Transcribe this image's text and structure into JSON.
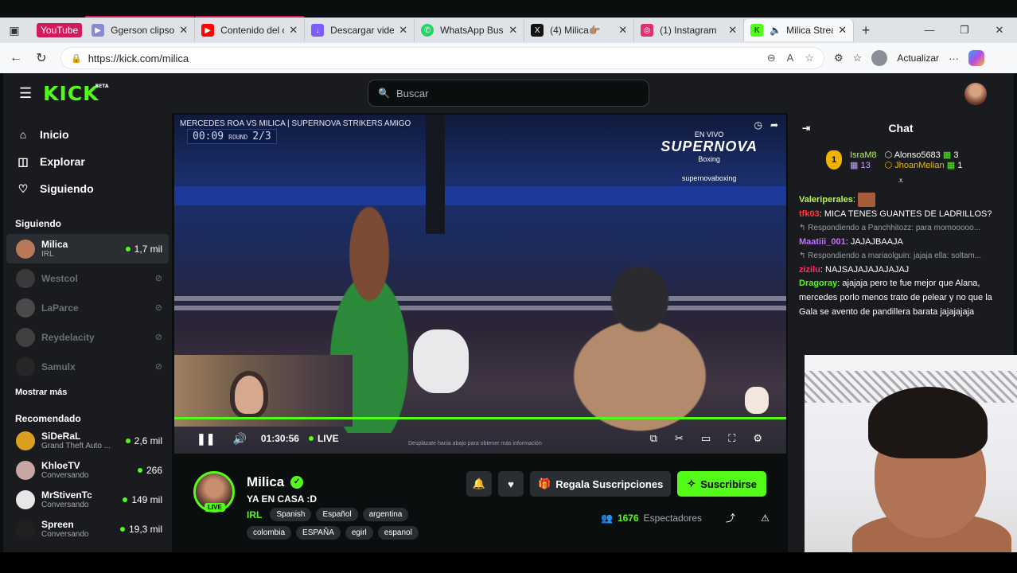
{
  "browser": {
    "tab_group_label": "YouTube",
    "tabs": [
      {
        "title": "Ggerson clipso -",
        "icon": "video-editor-icon",
        "color": "#8a8ad0"
      },
      {
        "title": "Contenido del c",
        "icon": "youtube-icon",
        "color": "#ff0000"
      },
      {
        "title": "Descargar video",
        "icon": "download-icon",
        "color": "#7c5cff"
      },
      {
        "title": "WhatsApp Busin",
        "icon": "whatsapp-icon",
        "color": "#25d366"
      },
      {
        "title": "(4) Milica👉🏽",
        "icon": "x-icon",
        "color": "#111111"
      },
      {
        "title": "(1) Instagram",
        "icon": "instagram-icon",
        "color": "#e1306c"
      },
      {
        "title": "Milica Strea",
        "icon": "kick-icon",
        "color": "#53fc18"
      }
    ],
    "url": "https://kick.com/milica",
    "update_label": "Actualizar"
  },
  "kick": {
    "logo": "KICK",
    "logo_badge": "BETA",
    "search_placeholder": "Buscar",
    "nav": [
      {
        "label": "Inicio",
        "icon": "home-icon"
      },
      {
        "label": "Explorar",
        "icon": "compass-icon"
      },
      {
        "label": "Siguiendo",
        "icon": "heart-icon"
      }
    ],
    "following_title": "Siguiendo",
    "following": [
      {
        "name": "Milica",
        "sub": "IRL",
        "viewers": "1,7 mil",
        "color": "#b8785a"
      },
      {
        "name": "Westcol",
        "color": "#3a3a3a"
      },
      {
        "name": "LaParce",
        "color": "#4a4a4a"
      },
      {
        "name": "Reydelacity",
        "color": "#404040"
      },
      {
        "name": "Samulx",
        "color": "#262626"
      }
    ],
    "show_more": "Mostrar más",
    "recommended_title": "Recomendado",
    "recommended": [
      {
        "name": "SiDeRaL",
        "sub": "Grand Theft Auto ...",
        "viewers": "2,6 mil",
        "color": "#d9a020"
      },
      {
        "name": "KhloeTV",
        "sub": "Conversando",
        "viewers": "266",
        "color": "#c9a6a0"
      },
      {
        "name": "MrStivenTc",
        "sub": "Conversando",
        "viewers": "149 mil",
        "color": "#e7e7e7"
      },
      {
        "name": "Spreen",
        "sub": "Conversando",
        "viewers": "19,3 mil",
        "color": "#202020"
      }
    ]
  },
  "video": {
    "title": "MERCEDES ROA VS MILICA | SUPERNOVA STRIKERS AMIGO",
    "clock": "00:09",
    "round_label": "ROUND",
    "round": "2/3",
    "sponsor_live": "EN VIVO",
    "sponsor_brand": "SUPERNOVA",
    "sponsor_sub": "Boxing",
    "sponsor_handle": "supernovaboxing",
    "elapsed": "01:30:56",
    "live_label": "LIVE",
    "hint": "Desplázate hacia abajo para obtener más información"
  },
  "stream": {
    "name": "Milica",
    "title": "YA EN CASA :D",
    "live_tag": "LIVE",
    "category": "IRL",
    "tags": [
      "Spanish",
      "Español",
      "argentina",
      "colombia",
      "ESPAÑA",
      "egirl",
      "espanol"
    ],
    "gift_label": "Regala Suscripciones",
    "subscribe_label": "Suscribirse",
    "viewers": "1676",
    "viewers_label": "Espectadores"
  },
  "chat": {
    "title": "Chat",
    "leaders": [
      {
        "name": "IsraM8",
        "count": "13",
        "rank": "1"
      },
      {
        "name": "Alonso5683",
        "count": "3"
      },
      {
        "name": "JhoanMelian",
        "count": "1"
      }
    ],
    "messages": [
      {
        "user": "Valeriperales",
        "text": ""
      },
      {
        "user": "tfk03",
        "text": "MICA TENES GUANTES DE LADRILLOS?"
      },
      {
        "reply": "Respondiendo a Panchhitozz: para momooooo...",
        "user": "Maatiii_001",
        "text": "JAJAJBAAJA"
      },
      {
        "reply": "Respondiendo a mariaolguin: jajaja ella: soltam...",
        "user": "zizilu",
        "text": "NAJSAJAJAJAJAJAJ"
      },
      {
        "user": "Dragoray",
        "text": "ajajaja pero te fue mejor que Alana, mercedes porlo menos trato de pelear y no que la Gala se avento de pandillera barata jajajajaja"
      }
    ]
  }
}
